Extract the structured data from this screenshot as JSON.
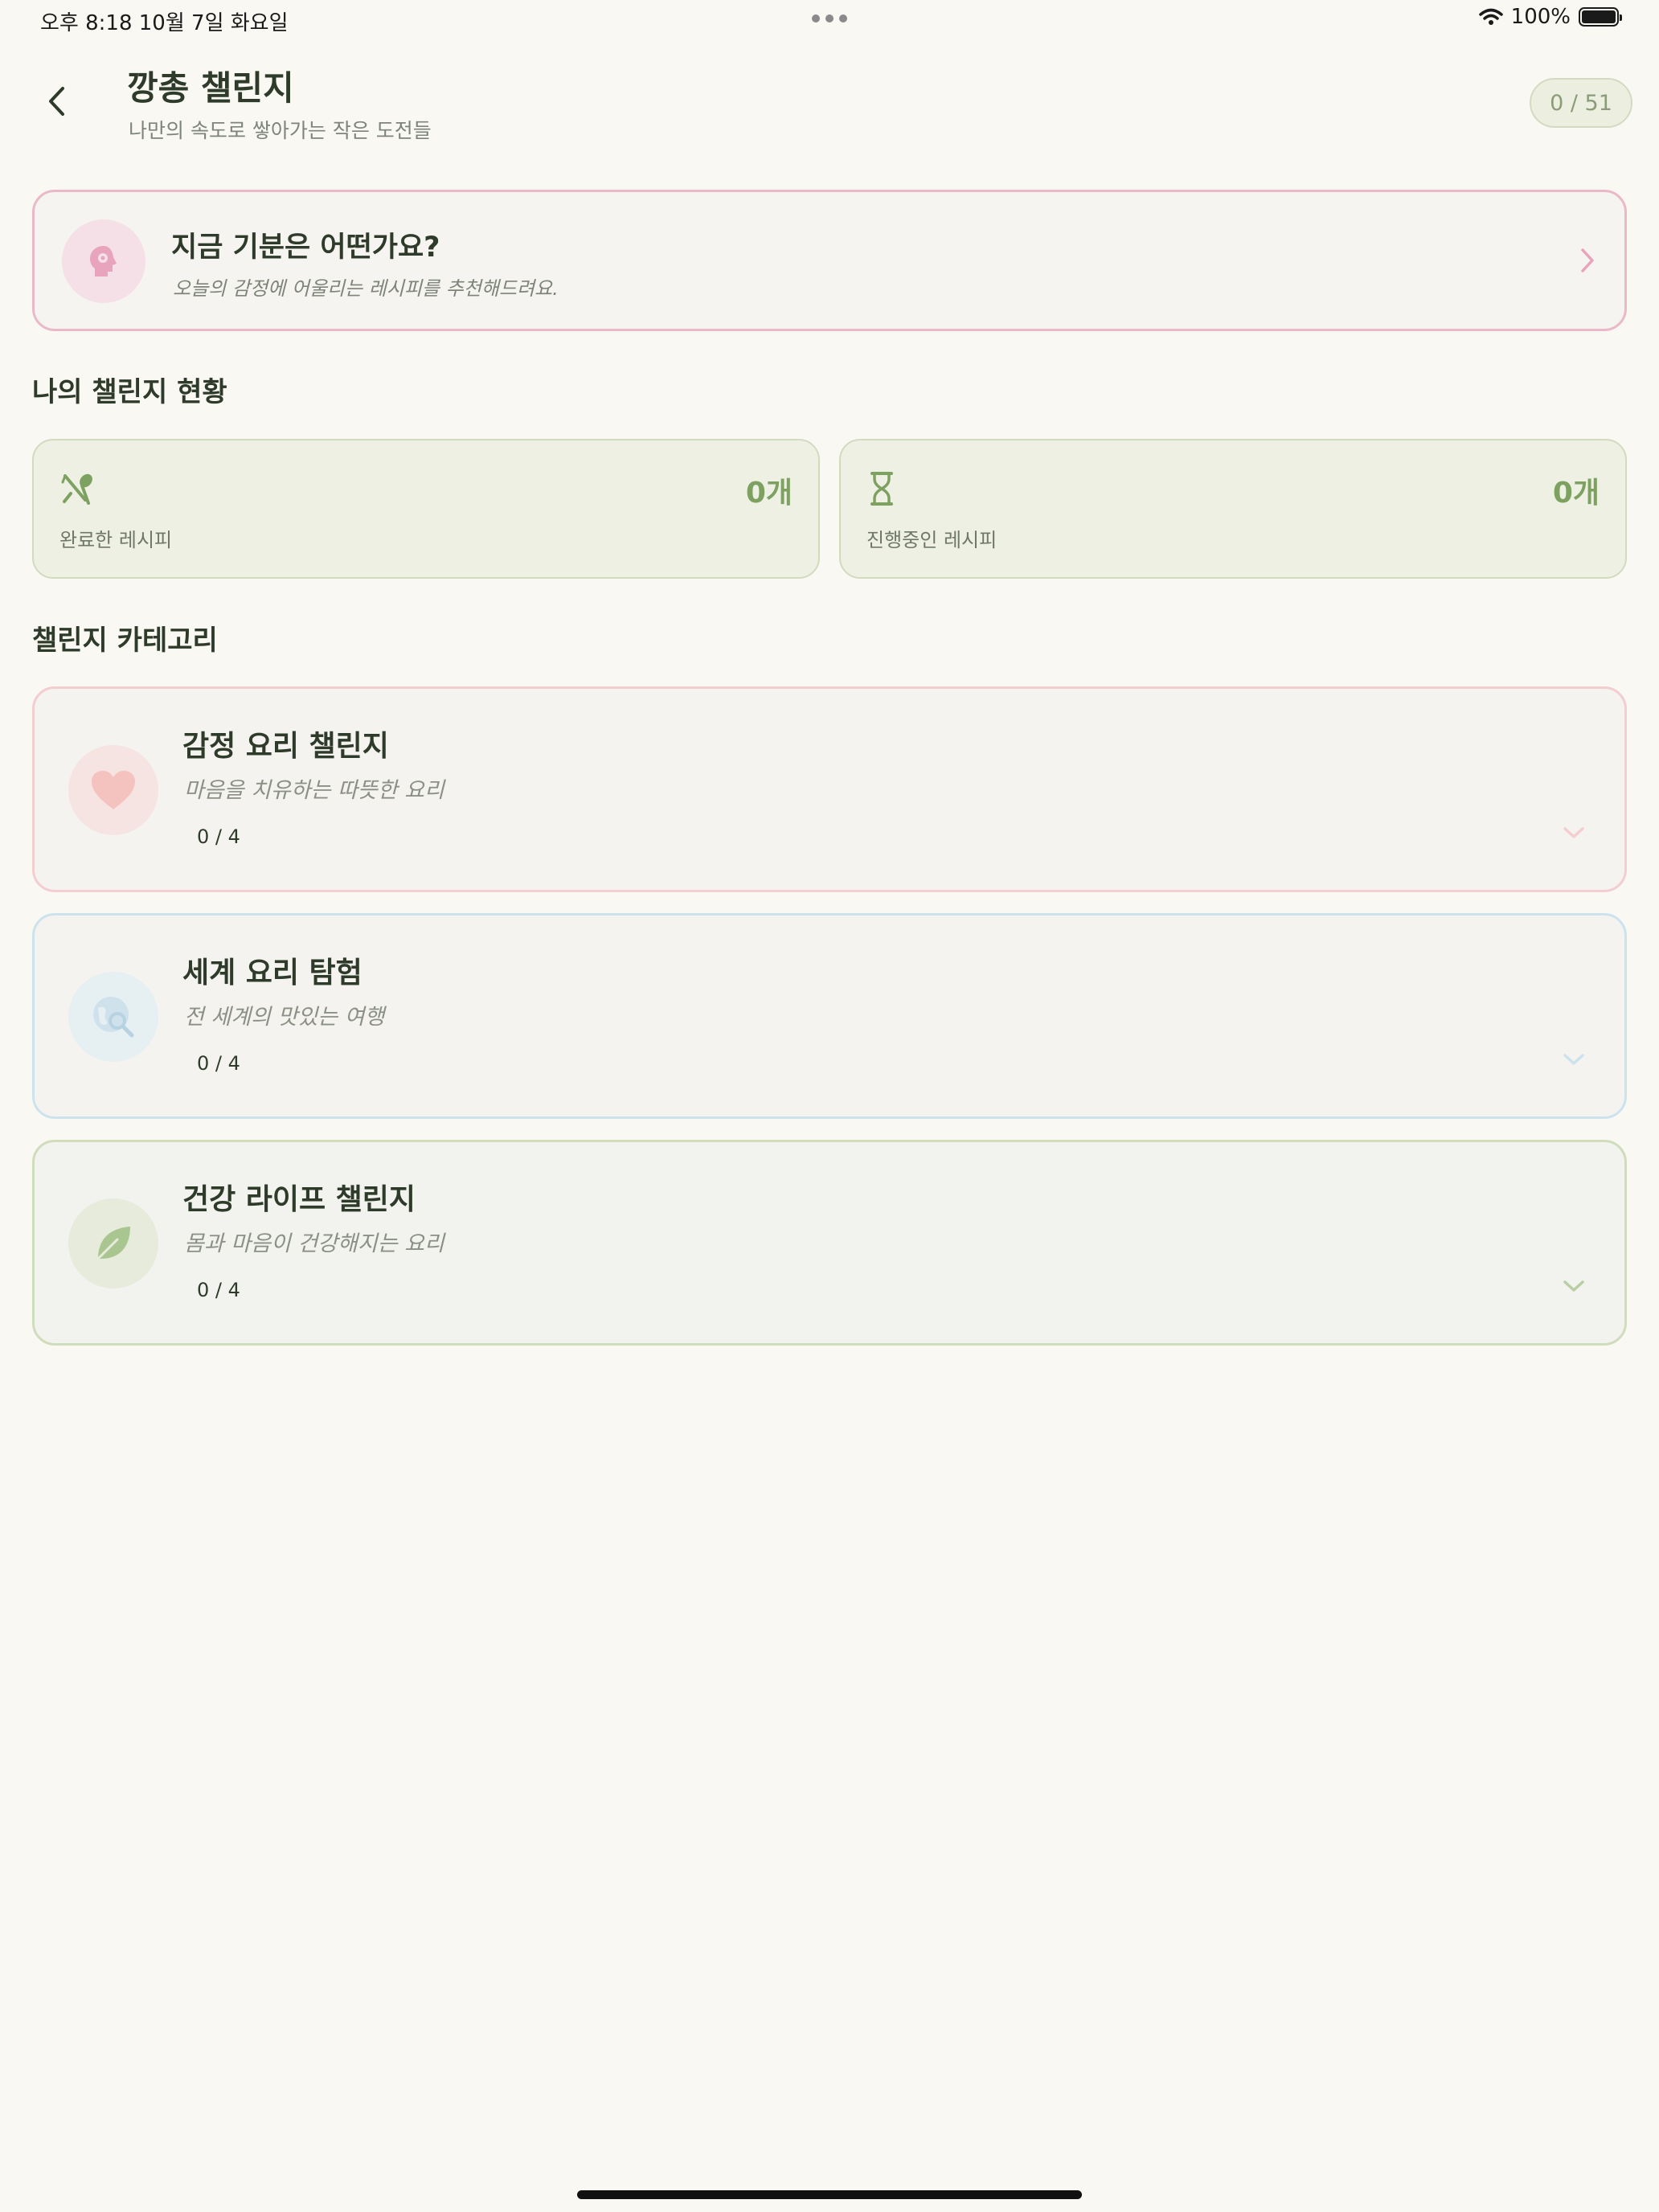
{
  "status_bar": {
    "time_date": "오후 8:18   10월 7일 화요일",
    "battery": "100%"
  },
  "header": {
    "title": "깡총 챌린지",
    "subtitle": "나만의 속도로 쌓아가는 작은 도전들",
    "progress": "0 / 51"
  },
  "mood_card": {
    "title": "지금 기분은 어떤가요?",
    "description": "오늘의 감정에 어울리는 레시피를 추천해드려요.",
    "icon": "mind-icon"
  },
  "stats": {
    "section_title": "나의 챌린지 현황",
    "completed": {
      "count": "0개",
      "label": "완료한 레시피",
      "icon": "utensils-icon"
    },
    "in_progress": {
      "count": "0개",
      "label": "진행중인 레시피",
      "icon": "hourglass-icon"
    }
  },
  "categories": {
    "section_title": "챌린지 카테고리",
    "items": [
      {
        "title": "감정 요리 챌린지",
        "description": "마음을 치유하는 따뜻한 요리",
        "progress": "0 / 4",
        "icon": "heart-icon",
        "accent": "#f3cdd0"
      },
      {
        "title": "세계 요리 탐험",
        "description": "전 세계의 맛있는 여행",
        "progress": "0 / 4",
        "icon": "globe-search-icon",
        "accent": "#cce3ee"
      },
      {
        "title": "건강 라이프 챌린지",
        "description": "몸과 마음이 건강해지는 요리",
        "progress": "0 / 4",
        "icon": "leaf-icon",
        "accent": "#cfddbc"
      }
    ]
  },
  "colors": {
    "background": "#f9f8f3",
    "primary_green": "#7da160",
    "mood_pink": "#eab9c9"
  }
}
